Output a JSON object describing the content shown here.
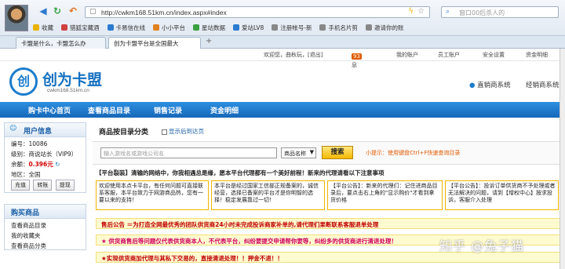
{
  "browser": {
    "url": "http://cwkm168.51km.cn/index.aspx#index",
    "search_placeholder": "窗口00后杀人的",
    "bookmarks": [
      {
        "label": "收藏",
        "icon": "star-icon",
        "color": "#e8b400"
      },
      {
        "label": "猎狐宝藏酒",
        "icon": "site-icon",
        "color": "#d04040"
      },
      {
        "label": "卡易信在线",
        "icon": "site-icon",
        "color": "#2b7bd0"
      },
      {
        "label": "小小平台",
        "icon": "site-icon",
        "color": "#e08020"
      },
      {
        "label": "星站数据",
        "icon": "site-icon",
        "color": "#3aa040"
      },
      {
        "label": "爱站LV8",
        "icon": "site-icon",
        "color": "#2b7bd0"
      },
      {
        "label": "注册帐号-新",
        "icon": "page-icon",
        "color": "#888888"
      },
      {
        "label": "手机名片剪",
        "icon": "page-icon",
        "color": "#888888"
      },
      {
        "label": "邀请你的账",
        "icon": "page-icon",
        "color": "#888888"
      }
    ],
    "tabs": [
      {
        "label": "卡盟是什么，卡盟怎么办"
      },
      {
        "label": "创为卡盟平台是全国最大"
      }
    ]
  },
  "top_links": {
    "welcome": "欢迎您，曲秋玩，[退出]",
    "messages_label": "消息",
    "messages_count": "93",
    "items": [
      "我的账户",
      "员工账户",
      "安全设置",
      "资金明细"
    ]
  },
  "header": {
    "logo_char": "创",
    "title": "创为卡盟",
    "subtitle": "cwkm168.51km.cn",
    "system_links": [
      "直销商系统",
      "经销商系统"
    ]
  },
  "nav": [
    "购卡中心首页",
    "查看商品目录",
    "销售记录",
    "资金明细"
  ],
  "user_info": {
    "heading": "用户信息",
    "rows": [
      {
        "label": "编号：",
        "value": "10086"
      },
      {
        "label": "级别：",
        "value": "商说站长（VIP9）"
      },
      {
        "label": "余额：",
        "value": "0.396元"
      },
      {
        "label": "地区：",
        "value": "全国"
      }
    ],
    "buttons": [
      "充值",
      "转账",
      "提现"
    ]
  },
  "purchase_menu": {
    "heading": "购买商品",
    "items": [
      "查看商品目录",
      "我的收藏夹",
      "查看商品分类"
    ]
  },
  "content": {
    "title": "商品按目录分类",
    "sort_label": "显示后到达页",
    "keyword_placeholder": "输入游戏名或游戏公司名",
    "select_value": "商品名称",
    "search_button": "搜索",
    "tip": "小提示：使用键盘Ctrl+F快速查询目录",
    "notice_bar": "【平台裂装】清输的网络中，你我相遇总是缘，愿本平台代理都有一个美好前程！新来的代理请看以下注意事项",
    "notices": [
      "欢迎使用本点卡平台，有任何问题可直接联系客服，本平台致力于网游商品热，您有一要以来的支持！",
      "本平台是经过国家工信部正规备案的，诚信经营，选择已备案的平台才是你明智的选择！稳定发展靠过一切！",
      "【平台公告】：新来的代理们：记住进商品目录后，要点击右上角的\"显示购价\"才看到拿货价格",
      "【平台公告】：投诉订单供货商不予处理或者无法解决的问题，请到【增权中心】按求投诉，客服介入处理"
    ],
    "red_bars": [
      "售后公告 ＝为打造全网最优秀的团队供货商24小时未完成投诉商家补单的,请代理们果断联系客服退单处理",
      "★ 供货商售后等问题仅代表供货商本人，不代表平台，纠纷要提交申请帮你要等，纠纷多的供货商进行清退处理！",
      "★实现供货商加代理与其私下交易的，直接清退处理！！押金不退！！"
    ]
  },
  "watermark": "知乎 @兔子猫"
}
